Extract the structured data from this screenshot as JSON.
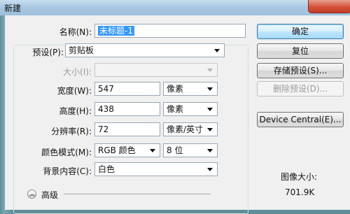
{
  "window": {
    "title": "新建"
  },
  "form": {
    "name": {
      "label": "名称(N):",
      "value": "未标题-1"
    },
    "preset": {
      "label": "预设(P):",
      "value": "剪贴板"
    },
    "size": {
      "label": "大小(I):",
      "value": ""
    },
    "width": {
      "label": "宽度(W):",
      "value": "547",
      "unit": "像素"
    },
    "height": {
      "label": "高度(H):",
      "value": "438",
      "unit": "像素"
    },
    "resolution": {
      "label": "分辨率(R):",
      "value": "72",
      "unit": "像素/英寸"
    },
    "color_mode": {
      "label": "颜色模式(M):",
      "value": "RGB 颜色",
      "depth": "8 位"
    },
    "background": {
      "label": "背景内容(C):",
      "value": "白色"
    },
    "advanced": {
      "label": "高级"
    }
  },
  "buttons": {
    "ok": "确定",
    "reset": "复位",
    "save_preset": "存储预设(S)...",
    "delete_preset": "删除预设(D)...",
    "device_central": "Device Central(E)..."
  },
  "image_size": {
    "label": "图像大小:",
    "value": "701.9K"
  }
}
